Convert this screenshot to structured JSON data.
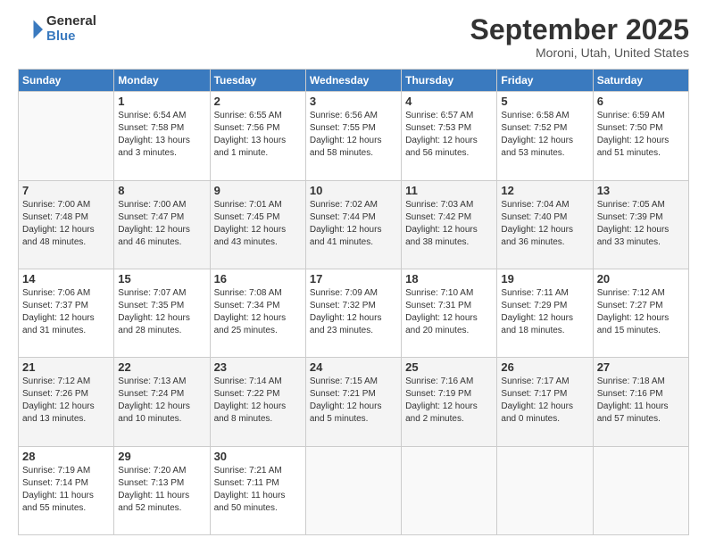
{
  "header": {
    "logo_general": "General",
    "logo_blue": "Blue",
    "month_title": "September 2025",
    "location": "Moroni, Utah, United States"
  },
  "weekdays": [
    "Sunday",
    "Monday",
    "Tuesday",
    "Wednesday",
    "Thursday",
    "Friday",
    "Saturday"
  ],
  "weeks": [
    [
      {
        "day": "",
        "info": ""
      },
      {
        "day": "1",
        "info": "Sunrise: 6:54 AM\nSunset: 7:58 PM\nDaylight: 13 hours\nand 3 minutes."
      },
      {
        "day": "2",
        "info": "Sunrise: 6:55 AM\nSunset: 7:56 PM\nDaylight: 13 hours\nand 1 minute."
      },
      {
        "day": "3",
        "info": "Sunrise: 6:56 AM\nSunset: 7:55 PM\nDaylight: 12 hours\nand 58 minutes."
      },
      {
        "day": "4",
        "info": "Sunrise: 6:57 AM\nSunset: 7:53 PM\nDaylight: 12 hours\nand 56 minutes."
      },
      {
        "day": "5",
        "info": "Sunrise: 6:58 AM\nSunset: 7:52 PM\nDaylight: 12 hours\nand 53 minutes."
      },
      {
        "day": "6",
        "info": "Sunrise: 6:59 AM\nSunset: 7:50 PM\nDaylight: 12 hours\nand 51 minutes."
      }
    ],
    [
      {
        "day": "7",
        "info": "Sunrise: 7:00 AM\nSunset: 7:48 PM\nDaylight: 12 hours\nand 48 minutes."
      },
      {
        "day": "8",
        "info": "Sunrise: 7:00 AM\nSunset: 7:47 PM\nDaylight: 12 hours\nand 46 minutes."
      },
      {
        "day": "9",
        "info": "Sunrise: 7:01 AM\nSunset: 7:45 PM\nDaylight: 12 hours\nand 43 minutes."
      },
      {
        "day": "10",
        "info": "Sunrise: 7:02 AM\nSunset: 7:44 PM\nDaylight: 12 hours\nand 41 minutes."
      },
      {
        "day": "11",
        "info": "Sunrise: 7:03 AM\nSunset: 7:42 PM\nDaylight: 12 hours\nand 38 minutes."
      },
      {
        "day": "12",
        "info": "Sunrise: 7:04 AM\nSunset: 7:40 PM\nDaylight: 12 hours\nand 36 minutes."
      },
      {
        "day": "13",
        "info": "Sunrise: 7:05 AM\nSunset: 7:39 PM\nDaylight: 12 hours\nand 33 minutes."
      }
    ],
    [
      {
        "day": "14",
        "info": "Sunrise: 7:06 AM\nSunset: 7:37 PM\nDaylight: 12 hours\nand 31 minutes."
      },
      {
        "day": "15",
        "info": "Sunrise: 7:07 AM\nSunset: 7:35 PM\nDaylight: 12 hours\nand 28 minutes."
      },
      {
        "day": "16",
        "info": "Sunrise: 7:08 AM\nSunset: 7:34 PM\nDaylight: 12 hours\nand 25 minutes."
      },
      {
        "day": "17",
        "info": "Sunrise: 7:09 AM\nSunset: 7:32 PM\nDaylight: 12 hours\nand 23 minutes."
      },
      {
        "day": "18",
        "info": "Sunrise: 7:10 AM\nSunset: 7:31 PM\nDaylight: 12 hours\nand 20 minutes."
      },
      {
        "day": "19",
        "info": "Sunrise: 7:11 AM\nSunset: 7:29 PM\nDaylight: 12 hours\nand 18 minutes."
      },
      {
        "day": "20",
        "info": "Sunrise: 7:12 AM\nSunset: 7:27 PM\nDaylight: 12 hours\nand 15 minutes."
      }
    ],
    [
      {
        "day": "21",
        "info": "Sunrise: 7:12 AM\nSunset: 7:26 PM\nDaylight: 12 hours\nand 13 minutes."
      },
      {
        "day": "22",
        "info": "Sunrise: 7:13 AM\nSunset: 7:24 PM\nDaylight: 12 hours\nand 10 minutes."
      },
      {
        "day": "23",
        "info": "Sunrise: 7:14 AM\nSunset: 7:22 PM\nDaylight: 12 hours\nand 8 minutes."
      },
      {
        "day": "24",
        "info": "Sunrise: 7:15 AM\nSunset: 7:21 PM\nDaylight: 12 hours\nand 5 minutes."
      },
      {
        "day": "25",
        "info": "Sunrise: 7:16 AM\nSunset: 7:19 PM\nDaylight: 12 hours\nand 2 minutes."
      },
      {
        "day": "26",
        "info": "Sunrise: 7:17 AM\nSunset: 7:17 PM\nDaylight: 12 hours\nand 0 minutes."
      },
      {
        "day": "27",
        "info": "Sunrise: 7:18 AM\nSunset: 7:16 PM\nDaylight: 11 hours\nand 57 minutes."
      }
    ],
    [
      {
        "day": "28",
        "info": "Sunrise: 7:19 AM\nSunset: 7:14 PM\nDaylight: 11 hours\nand 55 minutes."
      },
      {
        "day": "29",
        "info": "Sunrise: 7:20 AM\nSunset: 7:13 PM\nDaylight: 11 hours\nand 52 minutes."
      },
      {
        "day": "30",
        "info": "Sunrise: 7:21 AM\nSunset: 7:11 PM\nDaylight: 11 hours\nand 50 minutes."
      },
      {
        "day": "",
        "info": ""
      },
      {
        "day": "",
        "info": ""
      },
      {
        "day": "",
        "info": ""
      },
      {
        "day": "",
        "info": ""
      }
    ]
  ]
}
